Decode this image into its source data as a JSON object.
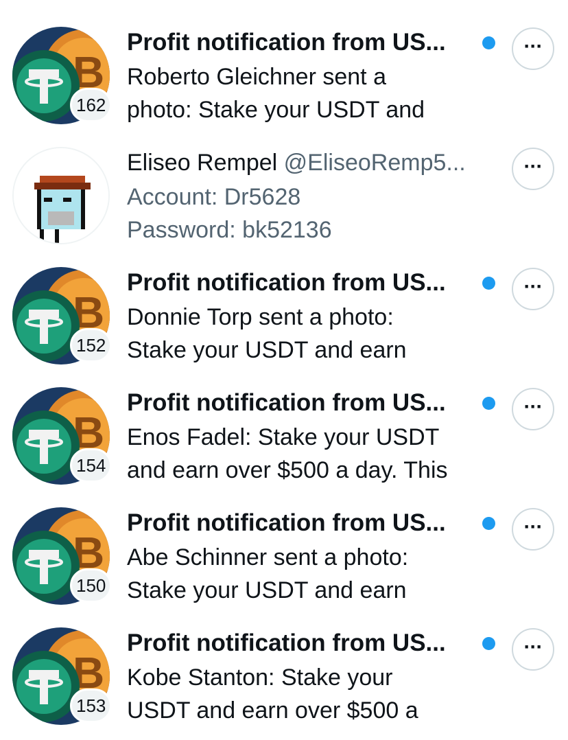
{
  "rows": [
    {
      "type": "notification",
      "title": "Profit notification from US...",
      "line1": "Roberto Gleichner sent a",
      "line2": "photo: Stake your USDT and",
      "count": "162",
      "unread": true
    },
    {
      "type": "message",
      "name": "Eliseo Rempel",
      "handle": "@EliseoRemp5...",
      "line1": "Account: Dr5628",
      "line2": "Password: bk52136",
      "unread": false
    },
    {
      "type": "notification",
      "title": "Profit notification from US...",
      "line1": "Donnie Torp sent a photo:",
      "line2": "Stake your USDT and earn",
      "count": "152",
      "unread": true
    },
    {
      "type": "notification",
      "title": "Profit notification from US...",
      "line1": "Enos Fadel: Stake your USDT",
      "line2": "and earn over $500 a day. This",
      "count": "154",
      "unread": true
    },
    {
      "type": "notification",
      "title": "Profit notification from US...",
      "line1": "Abe Schinner sent a photo:",
      "line2": "Stake your USDT and earn",
      "count": "150",
      "unread": true
    },
    {
      "type": "notification",
      "title": "Profit notification from US...",
      "line1": "Kobe Stanton: Stake your",
      "line2": "USDT and earn over $500 a",
      "count": "153",
      "unread": true
    }
  ],
  "more_label": "···",
  "colors": {
    "accent": "#1d9bf0",
    "text": "#0f1419",
    "muted": "#536471",
    "badge_bg": "#eff3f4"
  },
  "icons": {
    "avatar_group": "tether-bitcoin-coins-avatar",
    "avatar_user": "pixel-art-avatar",
    "more": "more-icon",
    "unread": "unread-dot"
  }
}
